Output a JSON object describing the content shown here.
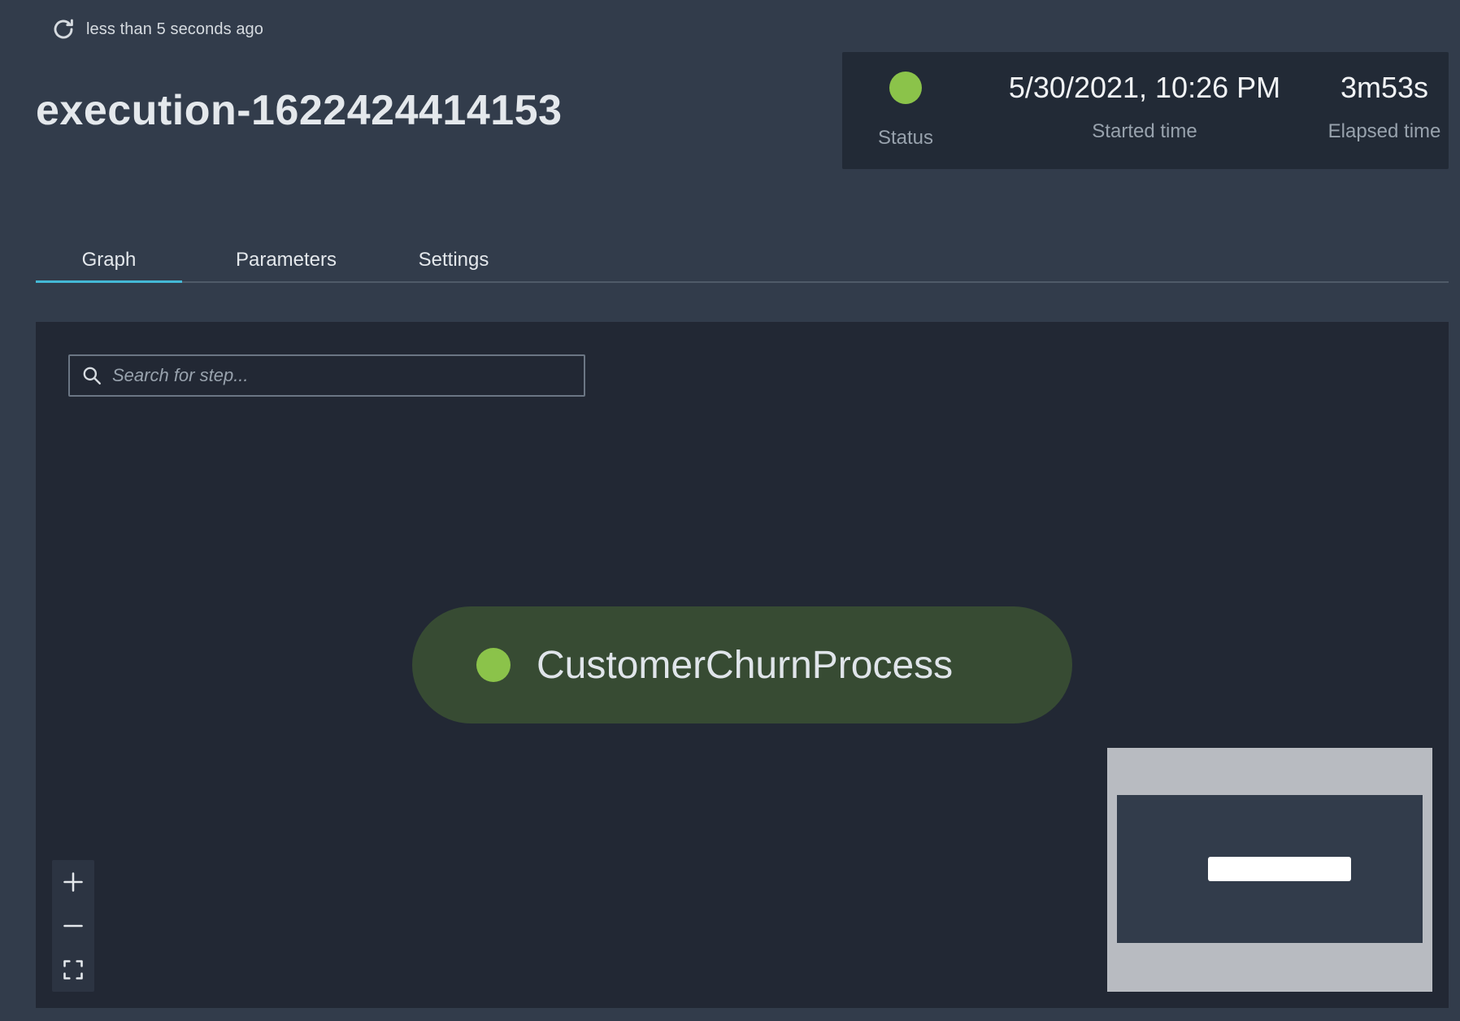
{
  "header": {
    "refresh_icon": "refresh-icon",
    "last_updated": "less than 5 seconds ago",
    "title": "execution-1622424414153"
  },
  "summary": {
    "status_color": "#8bc34a",
    "status_label": "Status",
    "started_time_value": "5/30/2021, 10:26 PM",
    "started_time_label": "Started time",
    "elapsed_time_value": "3m53s",
    "elapsed_time_label": "Elapsed time"
  },
  "tabs": [
    {
      "label": "Graph",
      "active": true
    },
    {
      "label": "Parameters",
      "active": false
    },
    {
      "label": "Settings",
      "active": false
    }
  ],
  "graph": {
    "search_placeholder": "Search for step...",
    "search_value": "",
    "nodes": [
      {
        "label": "CustomerChurnProcess",
        "status_color": "#8bc34a"
      }
    ],
    "zoom_controls": [
      "zoom-in-icon",
      "zoom-out-icon",
      "fit-to-screen-icon"
    ]
  },
  "colors": {
    "background": "#323c4b",
    "panel": "#222a36",
    "canvas": "#222834",
    "accent": "#44b9d6",
    "success": "#8bc34a",
    "node_fill": "#374b33"
  }
}
